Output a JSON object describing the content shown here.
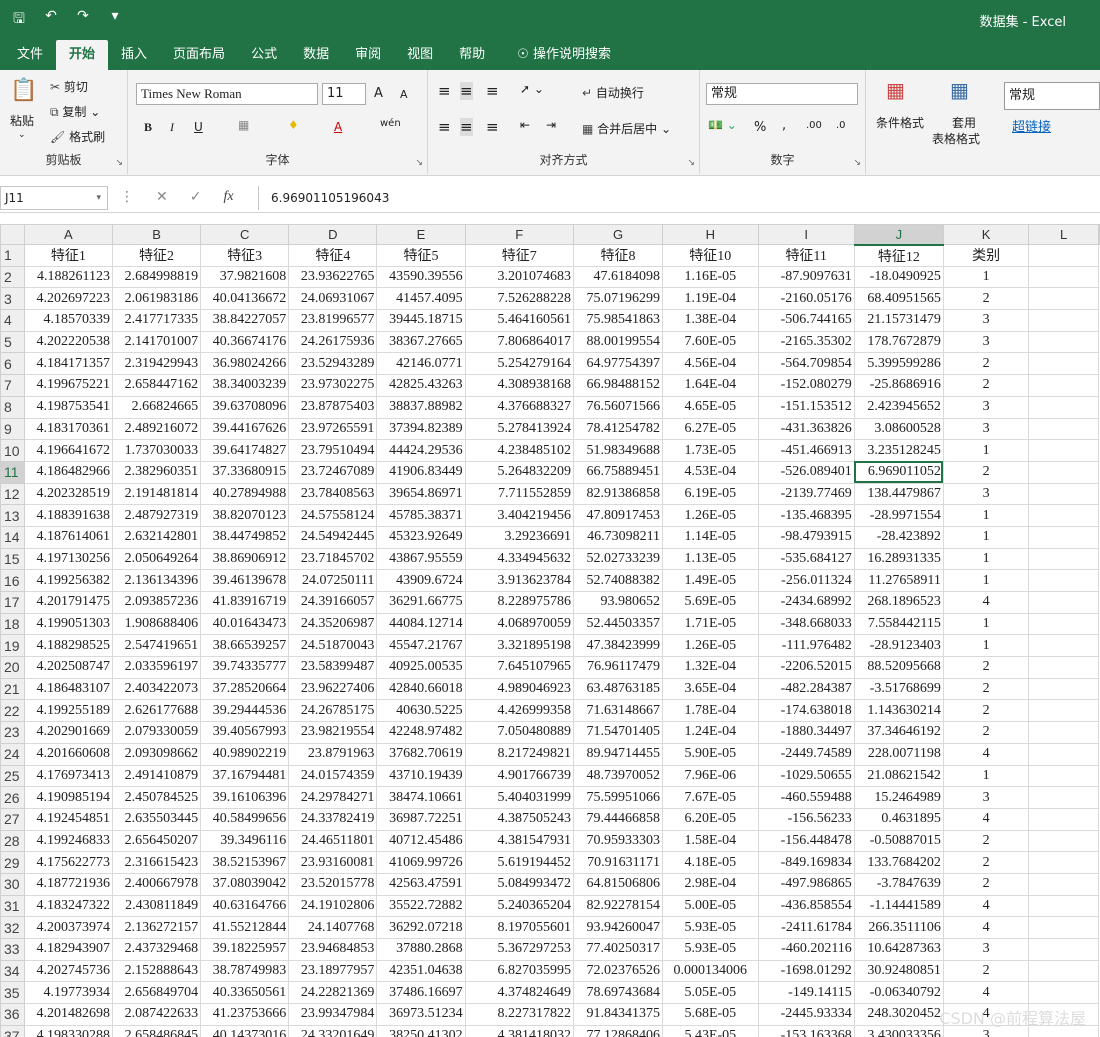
{
  "window": {
    "title": "数据集  -  Excel",
    "qat_icons": [
      "save-icon",
      "undo-icon",
      "redo-icon",
      "customize-icon"
    ]
  },
  "tabs": [
    "文件",
    "开始",
    "插入",
    "页面布局",
    "公式",
    "数据",
    "审阅",
    "视图",
    "帮助",
    "操作说明搜索"
  ],
  "ribbon": {
    "clipboard": {
      "paste": "粘贴",
      "cut": "剪切",
      "copy": "复制",
      "format_painter": "格式刷",
      "label": "剪贴板"
    },
    "font": {
      "name": "Times New Roman",
      "size": "11",
      "label": "字体",
      "bold": "B",
      "italic": "I",
      "underline": "U",
      "grow": "A",
      "shrink": "A",
      "color_a": "A",
      "wen": "wén"
    },
    "alignment": {
      "wrap": "自动换行",
      "merge": "合并后居中",
      "label": "对齐方式"
    },
    "number": {
      "format": "常规",
      "percent": "%",
      "comma": ",",
      "inc": ".00",
      "dec": ".0",
      "label": "数字"
    },
    "styles": {
      "cond": "条件格式",
      "table": "套用",
      "table2": "表格格式",
      "normal": "常规",
      "hyperlink": "超链接"
    }
  },
  "formula_bar": {
    "name_box": "J11",
    "value": "6.96901105196043",
    "fx": "fx"
  },
  "columns": [
    "A",
    "B",
    "C",
    "D",
    "E",
    "F",
    "G",
    "H",
    "I",
    "J",
    "K",
    "L"
  ],
  "headers": [
    "特征1",
    "特征2",
    "特征3",
    "特征4",
    "特征5",
    "特征7",
    "特征8",
    "特征10",
    "特征11",
    "特征12",
    "类别"
  ],
  "rows": [
    [
      "4.188261123",
      "2.684998819",
      "37.9821608",
      "23.93622765",
      "43590.39556",
      "3.201074683",
      "47.6184098",
      "1.16E-05",
      "-87.9097631",
      "-18.0490925",
      "1"
    ],
    [
      "4.202697223",
      "2.061983186",
      "40.04136672",
      "24.06931067",
      "41457.4095",
      "7.526288228",
      "75.07196299",
      "1.19E-04",
      "-2160.05176",
      "68.40951565",
      "2"
    ],
    [
      "4.18570339",
      "2.417717335",
      "38.84227057",
      "23.81996577",
      "39445.18715",
      "5.464160561",
      "75.98541863",
      "1.38E-04",
      "-506.744165",
      "21.15731479",
      "3"
    ],
    [
      "4.202220538",
      "2.141701007",
      "40.36674176",
      "24.26175936",
      "38367.27665",
      "7.806864017",
      "88.00199554",
      "7.60E-05",
      "-2165.35302",
      "178.7672879",
      "3"
    ],
    [
      "4.184171357",
      "2.319429943",
      "36.98024266",
      "23.52943289",
      "42146.0771",
      "5.254279164",
      "64.97754397",
      "4.56E-04",
      "-564.709854",
      "5.399599286",
      "2"
    ],
    [
      "4.199675221",
      "2.658447162",
      "38.34003239",
      "23.97302275",
      "42825.43263",
      "4.308938168",
      "66.98488152",
      "1.64E-04",
      "-152.080279",
      "-25.8686916",
      "2"
    ],
    [
      "4.198753541",
      "2.66824665",
      "39.63708096",
      "23.87875403",
      "38837.88982",
      "4.376688327",
      "76.56071566",
      "4.65E-05",
      "-151.153512",
      "2.423945652",
      "3"
    ],
    [
      "4.183170361",
      "2.489216072",
      "39.44167626",
      "23.97265591",
      "37394.82389",
      "5.278413924",
      "78.41254782",
      "6.27E-05",
      "-431.363826",
      "3.08600528",
      "3"
    ],
    [
      "4.196641672",
      "1.737030033",
      "39.64174827",
      "23.79510494",
      "44424.29536",
      "4.238485102",
      "51.98349688",
      "1.73E-05",
      "-451.466913",
      "3.235128245",
      "1"
    ],
    [
      "4.186482966",
      "2.382960351",
      "37.33680915",
      "23.72467089",
      "41906.83449",
      "5.264832209",
      "66.75889451",
      "4.53E-04",
      "-526.089401",
      "6.969011052",
      "2"
    ],
    [
      "4.202328519",
      "2.191481814",
      "40.27894988",
      "23.78408563",
      "39654.86971",
      "7.711552859",
      "82.91386858",
      "6.19E-05",
      "-2139.77469",
      "138.4479867",
      "3"
    ],
    [
      "4.188391638",
      "2.487927319",
      "38.82070123",
      "24.57558124",
      "45785.38371",
      "3.404219456",
      "47.80917453",
      "1.26E-05",
      "-135.468395",
      "-28.9971554",
      "1"
    ],
    [
      "4.187614061",
      "2.632142801",
      "38.44749852",
      "24.54942445",
      "45323.92649",
      "3.29236691",
      "46.73098211",
      "1.14E-05",
      "-98.4793915",
      "-28.423892",
      "1"
    ],
    [
      "4.197130256",
      "2.050649264",
      "38.86906912",
      "23.71845702",
      "43867.95559",
      "4.334945632",
      "52.02733239",
      "1.13E-05",
      "-535.684127",
      "16.28931335",
      "1"
    ],
    [
      "4.199256382",
      "2.136134396",
      "39.46139678",
      "24.07250111",
      "43909.6724",
      "3.913623784",
      "52.74088382",
      "1.49E-05",
      "-256.011324",
      "11.27658911",
      "1"
    ],
    [
      "4.201791475",
      "2.093857236",
      "41.83916719",
      "24.39166057",
      "36291.66775",
      "8.228975786",
      "93.980652",
      "5.69E-05",
      "-2434.68992",
      "268.1896523",
      "4"
    ],
    [
      "4.199051303",
      "1.908688406",
      "40.01643473",
      "24.35206987",
      "44084.12714",
      "4.068970059",
      "52.44503357",
      "1.71E-05",
      "-348.668033",
      "7.558442115",
      "1"
    ],
    [
      "4.188298525",
      "2.547419651",
      "38.66539257",
      "24.51870043",
      "45547.21767",
      "3.321895198",
      "47.38423999",
      "1.26E-05",
      "-111.976482",
      "-28.9123403",
      "1"
    ],
    [
      "4.202508747",
      "2.033596197",
      "39.74335777",
      "23.58399487",
      "40925.00535",
      "7.645107965",
      "76.96117479",
      "1.32E-04",
      "-2206.52015",
      "88.52095668",
      "2"
    ],
    [
      "4.186483107",
      "2.403422073",
      "37.28520664",
      "23.96227406",
      "42840.66018",
      "4.989046923",
      "63.48763185",
      "3.65E-04",
      "-482.284387",
      "-3.51768699",
      "2"
    ],
    [
      "4.199255189",
      "2.626177688",
      "39.29444536",
      "24.26785175",
      "40630.5225",
      "4.426999358",
      "71.63148667",
      "1.78E-04",
      "-174.638018",
      "1.143630214",
      "2"
    ],
    [
      "4.202901669",
      "2.079330059",
      "39.40567993",
      "23.98219554",
      "42248.97482",
      "7.050480889",
      "71.54701405",
      "1.24E-04",
      "-1880.34497",
      "37.34646192",
      "2"
    ],
    [
      "4.201660608",
      "2.093098662",
      "40.98902219",
      "23.8791963",
      "37682.70619",
      "8.217249821",
      "89.94714455",
      "5.90E-05",
      "-2449.74589",
      "228.0071198",
      "4"
    ],
    [
      "4.176973413",
      "2.491410879",
      "37.16794481",
      "24.01574359",
      "43710.19439",
      "4.901766739",
      "48.73970052",
      "7.96E-06",
      "-1029.50655",
      "21.08621542",
      "1"
    ],
    [
      "4.190985194",
      "2.450784525",
      "39.16106396",
      "24.29784271",
      "38474.10661",
      "5.404031999",
      "75.59951066",
      "7.67E-05",
      "-460.559488",
      "15.2464989",
      "3"
    ],
    [
      "4.192454851",
      "2.635503445",
      "40.58499656",
      "24.33782419",
      "36987.72251",
      "4.387505243",
      "79.44466858",
      "6.20E-05",
      "-156.56233",
      "0.4631895",
      "4"
    ],
    [
      "4.199246833",
      "2.656450207",
      "39.3496116",
      "24.46511801",
      "40712.45486",
      "4.381547931",
      "70.95933303",
      "1.58E-04",
      "-156.448478",
      "-0.50887015",
      "2"
    ],
    [
      "4.175622773",
      "2.316615423",
      "38.52153967",
      "23.93160081",
      "41069.99726",
      "5.619194452",
      "70.91631171",
      "4.18E-05",
      "-849.169834",
      "133.7684202",
      "2"
    ],
    [
      "4.187721936",
      "2.400667978",
      "37.08039042",
      "23.52015778",
      "42563.47591",
      "5.084993472",
      "64.81506806",
      "2.98E-04",
      "-497.986865",
      "-3.7847639",
      "2"
    ],
    [
      "4.183247322",
      "2.430811849",
      "40.63164766",
      "24.19102806",
      "35522.72882",
      "5.240365204",
      "82.92278154",
      "5.00E-05",
      "-436.858554",
      "-1.14441589",
      "4"
    ],
    [
      "4.200373974",
      "2.136272157",
      "41.55212844",
      "24.1407768",
      "36292.07218",
      "8.197055601",
      "93.94260047",
      "5.93E-05",
      "-2411.61784",
      "266.3511106",
      "4"
    ],
    [
      "4.182943907",
      "2.437329468",
      "39.18225957",
      "23.94684853",
      "37880.2868",
      "5.367297253",
      "77.40250317",
      "5.93E-05",
      "-460.202116",
      "10.64287363",
      "3"
    ],
    [
      "4.202745736",
      "2.152888643",
      "38.78749983",
      "23.18977957",
      "42351.04638",
      "6.827035995",
      "72.02376526",
      "0.000134006",
      "-1698.01292",
      "30.92480851",
      "2"
    ],
    [
      "4.19773934",
      "2.656849704",
      "40.33650561",
      "24.22821369",
      "37486.16697",
      "4.374824649",
      "78.69743684",
      "5.05E-05",
      "-149.14115",
      "-0.06340792",
      "4"
    ],
    [
      "4.201482698",
      "2.087422633",
      "41.23753666",
      "23.99347984",
      "36973.51234",
      "8.227317822",
      "91.84341375",
      "5.68E-05",
      "-2445.93334",
      "248.3020452",
      "4"
    ],
    [
      "4.198330288",
      "2.658486845",
      "40.14373016",
      "24.33201649",
      "38250.41302",
      "4.381418032",
      "77.12868406",
      "5.43E-05",
      "-153.163368",
      "3.430033356",
      "3"
    ]
  ],
  "active_cell": {
    "row": 11,
    "col": "J"
  },
  "watermark": "CSDN @前程算法屋",
  "colors": {
    "excel_green": "#217346",
    "ribbon_bg": "#f3f3f3",
    "hyperlink": "#0563c1"
  }
}
